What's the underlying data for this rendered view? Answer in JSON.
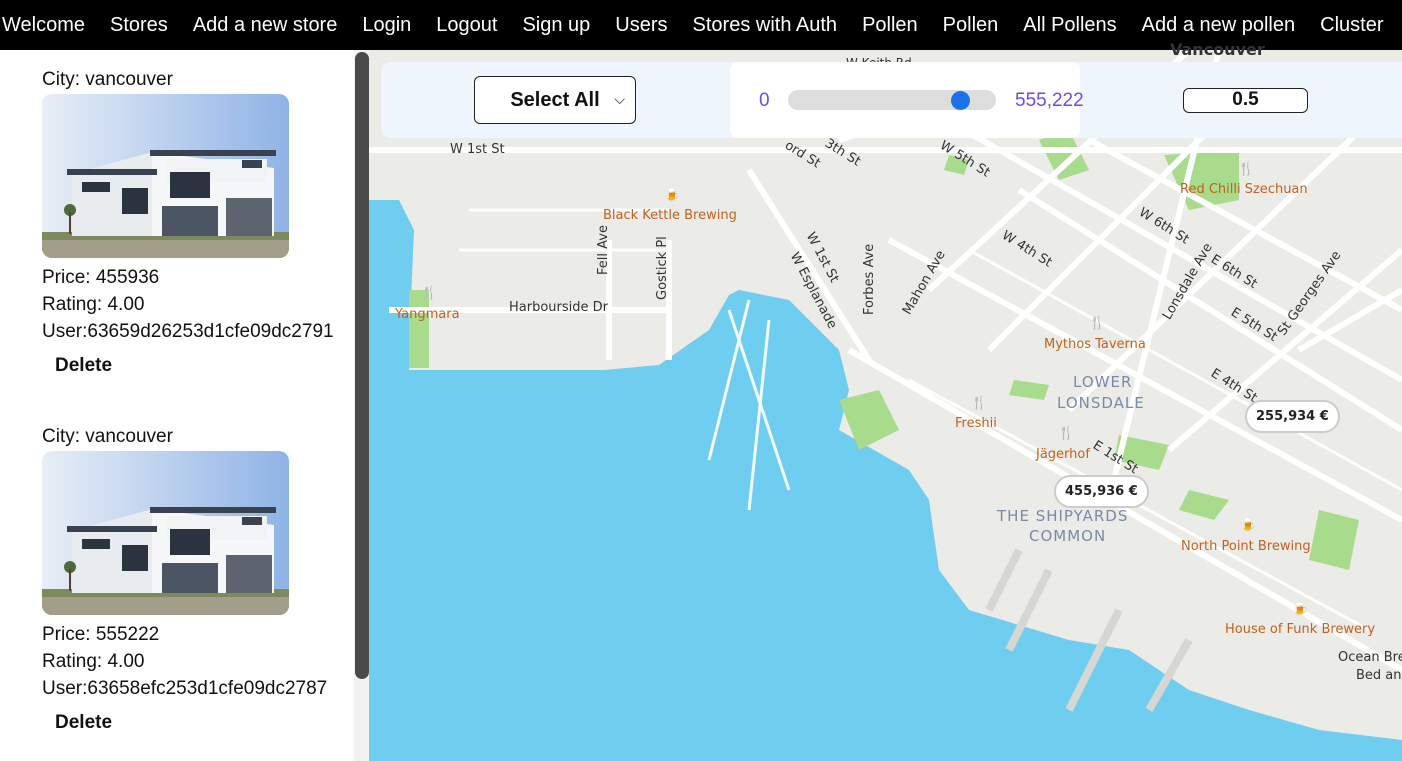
{
  "nav": {
    "items": [
      "Welcome",
      "Stores",
      "Add a new store",
      "Login",
      "Logout",
      "Sign up",
      "Users",
      "Stores with Auth",
      "Pollen",
      "Pollen",
      "All Pollens",
      "Add a new pollen",
      "Cluster"
    ]
  },
  "stores": [
    {
      "city": "City: vancouver",
      "price": "Price: 455936",
      "rating": "Rating: 4.00",
      "user": "User:63659d26253d1cfe09dc2791",
      "delete_label": "Delete"
    },
    {
      "city": "City: vancouver",
      "price": "Price: 555222",
      "rating": "Rating: 4.00",
      "user": "User:63658efc253d1cfe09dc2787",
      "delete_label": "Delete"
    }
  ],
  "controls": {
    "select_value": "Select All",
    "slider_min": "0",
    "slider_max": "555,222",
    "slider_fraction": 0.86,
    "number_value": "0.5"
  },
  "map": {
    "markers": [
      "255,934 €",
      "455,936 €"
    ],
    "area_labels": [
      "LOWER",
      "LONSDALE",
      "THE SHIPYARDS",
      "COMMON"
    ],
    "pois": [
      "Black Kettle Brewing",
      "Red Chilli Szechuan",
      "Yangmara",
      "Mythos Taverna",
      "Freshii",
      "Jägerhof",
      "North Point Brewing",
      "House of Funk Brewery",
      "Ocean Bre",
      "Bed and"
    ],
    "streets": [
      "W 1st St",
      "Harbourside Dr",
      "Fell Ave",
      "Gostick Pl",
      "W 1st St",
      "W Esplanade",
      "Forbes Ave",
      "Mahon Ave",
      "W 4th St",
      "W 6th St",
      "Lonsdale Ave",
      "E 6th St",
      "E 5th St",
      "St Georges Ave",
      "E 4th St",
      "E 1st St",
      "W 5th St",
      "3th St",
      "ord St",
      "Vancouver",
      "W Keith Rd"
    ],
    "colors": {
      "water": "#6fcdef",
      "land": "#ebebe7",
      "park": "#a8db8c",
      "road": "#ffffff",
      "poi": "#c2611f"
    }
  }
}
